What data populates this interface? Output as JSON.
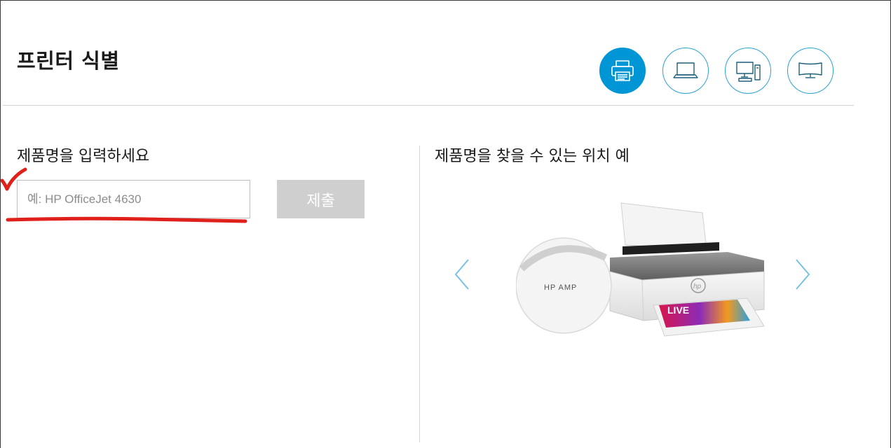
{
  "page": {
    "title": "프린터 식별"
  },
  "device_types": [
    {
      "name": "printer-icon",
      "active": true
    },
    {
      "name": "laptop-icon",
      "active": false
    },
    {
      "name": "desktop-icon",
      "active": false
    },
    {
      "name": "monitor-icon",
      "active": false
    }
  ],
  "form": {
    "label": "제품명을 입력하세요",
    "placeholder": "예: HP OfficeJet 4630",
    "value": "",
    "submit_label": "제출",
    "submit_enabled": false
  },
  "example": {
    "label": "제품명을 찾을 수 있는 위치 예",
    "zoom_text": "HP AMP",
    "paper_text": "LIVE"
  },
  "colors": {
    "accent": "#0096d6",
    "icon_outline": "#2aa3d6",
    "submit_disabled": "#cfcfcf",
    "annotation": "#e0201b"
  }
}
